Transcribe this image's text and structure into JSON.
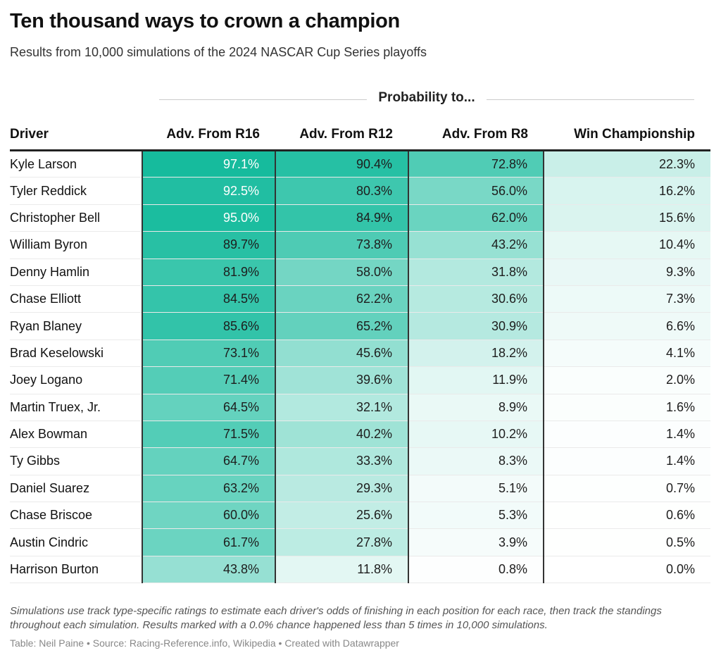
{
  "header": {
    "title": "Ten thousand ways to crown a champion",
    "subtitle": "Results from 10,000 simulations of the 2024 NASCAR Cup Series playoffs"
  },
  "colors": {
    "scale_max": "#0fb99a",
    "scale_min": "#ffffff",
    "text_dark": "#1d1d1d",
    "text_light": "#ffffff"
  },
  "chart_data": {
    "type": "table",
    "title": "Ten thousand ways to crown a champion",
    "subtitle": "Results from 10,000 simulations of the 2024 NASCAR Cup Series playoffs",
    "column_group_label": "Probability to...",
    "columns": [
      "Driver",
      "Adv. From R16",
      "Adv. From R12",
      "Adv. From R8",
      "Win Championship"
    ],
    "rows": [
      {
        "driver": "Kyle Larson",
        "values": [
          "97.1%",
          "90.4%",
          "72.8%",
          "22.3%"
        ]
      },
      {
        "driver": "Tyler Reddick",
        "values": [
          "92.5%",
          "80.3%",
          "56.0%",
          "16.2%"
        ]
      },
      {
        "driver": "Christopher Bell",
        "values": [
          "95.0%",
          "84.9%",
          "62.0%",
          "15.6%"
        ]
      },
      {
        "driver": "William Byron",
        "values": [
          "89.7%",
          "73.8%",
          "43.2%",
          "10.4%"
        ]
      },
      {
        "driver": "Denny Hamlin",
        "values": [
          "81.9%",
          "58.0%",
          "31.8%",
          "9.3%"
        ]
      },
      {
        "driver": "Chase Elliott",
        "values": [
          "84.5%",
          "62.2%",
          "30.6%",
          "7.3%"
        ]
      },
      {
        "driver": "Ryan Blaney",
        "values": [
          "85.6%",
          "65.2%",
          "30.9%",
          "6.6%"
        ]
      },
      {
        "driver": "Brad Keselowski",
        "values": [
          "73.1%",
          "45.6%",
          "18.2%",
          "4.1%"
        ]
      },
      {
        "driver": "Joey Logano",
        "values": [
          "71.4%",
          "39.6%",
          "11.9%",
          "2.0%"
        ]
      },
      {
        "driver": "Martin Truex, Jr.",
        "values": [
          "64.5%",
          "32.1%",
          "8.9%",
          "1.6%"
        ]
      },
      {
        "driver": "Alex Bowman",
        "values": [
          "71.5%",
          "40.2%",
          "10.2%",
          "1.4%"
        ]
      },
      {
        "driver": "Ty Gibbs",
        "values": [
          "64.7%",
          "33.3%",
          "8.3%",
          "1.4%"
        ]
      },
      {
        "driver": "Daniel Suarez",
        "values": [
          "63.2%",
          "29.3%",
          "5.1%",
          "0.7%"
        ]
      },
      {
        "driver": "Chase Briscoe",
        "values": [
          "60.0%",
          "25.6%",
          "5.3%",
          "0.6%"
        ]
      },
      {
        "driver": "Austin Cindric",
        "values": [
          "61.7%",
          "27.8%",
          "3.9%",
          "0.5%"
        ]
      },
      {
        "driver": "Harrison Burton",
        "values": [
          "43.8%",
          "11.8%",
          "0.8%",
          "0.0%"
        ]
      }
    ]
  },
  "footer": {
    "notes": "Simulations use track type-specific ratings to estimate each driver's odds of finishing in each position for each race, then track the standings throughout each simulation. Results marked with a 0.0% chance happened less than 5 times in 10,000 simulations.",
    "credit": "Table: Neil Paine • Source: Racing-Reference.info, Wikipedia • Created with Datawrapper"
  }
}
